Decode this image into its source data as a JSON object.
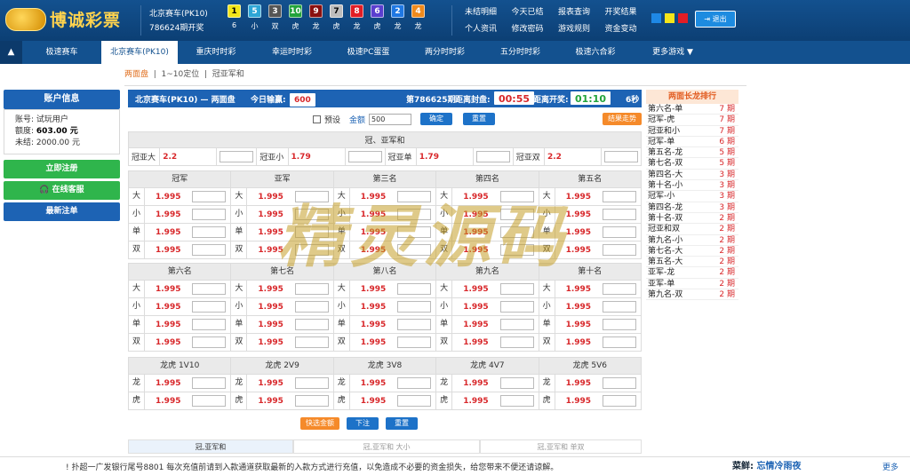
{
  "header": {
    "logo_text": "博诚彩票",
    "game_name": "北京赛车(PK10)",
    "draw_issue": "786624期开奖",
    "balls": [
      {
        "num": "1",
        "color": "#f2e51a",
        "text_color": "#000",
        "sub": "6"
      },
      {
        "num": "5",
        "color": "#2ea6d6",
        "text_color": "#fff",
        "sub": "小"
      },
      {
        "num": "3",
        "color": "#555555",
        "text_color": "#fff",
        "sub": "双"
      },
      {
        "num": "10",
        "color": "#22a33b",
        "text_color": "#fff",
        "sub": "虎"
      },
      {
        "num": "9",
        "color": "#8a1010",
        "text_color": "#fff",
        "sub": "龙"
      },
      {
        "num": "7",
        "color": "#bdbdbd",
        "text_color": "#000",
        "sub": "虎"
      },
      {
        "num": "8",
        "color": "#e21d25",
        "text_color": "#fff",
        "sub": "龙"
      },
      {
        "num": "6",
        "color": "#5a3fcf",
        "text_color": "#fff",
        "sub": "虎"
      },
      {
        "num": "2",
        "color": "#1f78e3",
        "text_color": "#fff",
        "sub": "龙"
      },
      {
        "num": "4",
        "color": "#f08a1c",
        "text_color": "#fff",
        "sub": "龙"
      }
    ],
    "nav_links": [
      "未结明细",
      "今天已结",
      "报表查询",
      "开奖结果",
      "个人资讯",
      "修改密码",
      "游戏规则",
      "资金变动"
    ],
    "theme_swatches": [
      "#1e88e5",
      "#f5e51a",
      "#e21d25"
    ],
    "logout_label": "退出"
  },
  "game_nav": {
    "items": [
      "极速赛车",
      "北京赛车(PK10)",
      "重庆时时彩",
      "幸运时时彩",
      "极速PC蛋蛋",
      "两分时时彩",
      "五分时时彩",
      "极速六合彩",
      "更多游戏 ▼"
    ],
    "active": 1
  },
  "subnav": {
    "items": [
      "两面盘",
      "1~10定位",
      "冠亚军和"
    ],
    "active": 0
  },
  "account": {
    "title": "账户信息",
    "rows": [
      {
        "label": "账号:",
        "value": "试玩用户"
      },
      {
        "label": "额度:",
        "value": "603.00 元",
        "bold": true
      },
      {
        "label": "未结:",
        "value": "2000.00 元"
      }
    ],
    "register": "立即注册",
    "service": "在线客服",
    "latest": "最新注单"
  },
  "main_bar": {
    "title": "北京赛车(PK10) — 两面盘",
    "today_label": "今日输赢:",
    "today_value": "600",
    "issue": "第786625期",
    "close_label": "距离封盘:",
    "close_time": "00:55",
    "open_label": "距离开奖:",
    "open_time": "01:10",
    "refresh": "6秒"
  },
  "controls": {
    "preset": "预设",
    "amount_label": "金额",
    "amount_value": "500",
    "confirm": "确定",
    "reset": "重置",
    "trend": "结果走势"
  },
  "gy": {
    "title": "冠、亚军和",
    "items": [
      {
        "label": "冠亚大",
        "odds": "2.2"
      },
      {
        "label": "冠亚小",
        "odds": "1.79"
      },
      {
        "label": "冠亚单",
        "odds": "1.79"
      },
      {
        "label": "冠亚双",
        "odds": "2.2"
      }
    ]
  },
  "positions_a": [
    {
      "title": "冠军",
      "rows": [
        [
          "大",
          "1.995"
        ],
        [
          "小",
          "1.995"
        ],
        [
          "单",
          "1.995"
        ],
        [
          "双",
          "1.995"
        ]
      ]
    },
    {
      "title": "亚军",
      "rows": [
        [
          "大",
          "1.995"
        ],
        [
          "小",
          "1.995"
        ],
        [
          "单",
          "1.995"
        ],
        [
          "双",
          "1.995"
        ]
      ]
    },
    {
      "title": "第三名",
      "rows": [
        [
          "大",
          "1.995"
        ],
        [
          "小",
          "1.995"
        ],
        [
          "单",
          "1.995"
        ],
        [
          "双",
          "1.995"
        ]
      ]
    },
    {
      "title": "第四名",
      "rows": [
        [
          "大",
          "1.995"
        ],
        [
          "小",
          "1.995"
        ],
        [
          "单",
          "1.995"
        ],
        [
          "双",
          "1.995"
        ]
      ]
    },
    {
      "title": "第五名",
      "rows": [
        [
          "大",
          "1.995"
        ],
        [
          "小",
          "1.995"
        ],
        [
          "单",
          "1.995"
        ],
        [
          "双",
          "1.995"
        ]
      ]
    }
  ],
  "positions_b": [
    {
      "title": "第六名",
      "rows": [
        [
          "大",
          "1.995"
        ],
        [
          "小",
          "1.995"
        ],
        [
          "单",
          "1.995"
        ],
        [
          "双",
          "1.995"
        ]
      ]
    },
    {
      "title": "第七名",
      "rows": [
        [
          "大",
          "1.995"
        ],
        [
          "小",
          "1.995"
        ],
        [
          "单",
          "1.995"
        ],
        [
          "双",
          "1.995"
        ]
      ]
    },
    {
      "title": "第八名",
      "rows": [
        [
          "大",
          "1.995"
        ],
        [
          "小",
          "1.995"
        ],
        [
          "单",
          "1.995"
        ],
        [
          "双",
          "1.995"
        ]
      ]
    },
    {
      "title": "第九名",
      "rows": [
        [
          "大",
          "1.995"
        ],
        [
          "小",
          "1.995"
        ],
        [
          "单",
          "1.995"
        ],
        [
          "双",
          "1.995"
        ]
      ]
    },
    {
      "title": "第十名",
      "rows": [
        [
          "大",
          "1.995"
        ],
        [
          "小",
          "1.995"
        ],
        [
          "单",
          "1.995"
        ],
        [
          "双",
          "1.995"
        ]
      ]
    }
  ],
  "dragon_tiger": [
    {
      "title": "龙虎 1V10",
      "rows": [
        [
          "龙",
          "1.995"
        ],
        [
          "虎",
          "1.995"
        ]
      ]
    },
    {
      "title": "龙虎 2V9",
      "rows": [
        [
          "龙",
          "1.995"
        ],
        [
          "虎",
          "1.995"
        ]
      ]
    },
    {
      "title": "龙虎 3V8",
      "rows": [
        [
          "龙",
          "1.995"
        ],
        [
          "虎",
          "1.995"
        ]
      ]
    },
    {
      "title": "龙虎 4V7",
      "rows": [
        [
          "龙",
          "1.995"
        ],
        [
          "虎",
          "1.995"
        ]
      ]
    },
    {
      "title": "龙虎 5V6",
      "rows": [
        [
          "龙",
          "1.995"
        ],
        [
          "虎",
          "1.995"
        ]
      ]
    }
  ],
  "bottom_buttons": {
    "quick": "快选金额",
    "submit": "下注",
    "reset": "重置"
  },
  "bottom_tabs": [
    "冠,亚军和",
    "冠,亚军和 大小",
    "冠,亚军和 单双"
  ],
  "ranking": {
    "title": "两面长龙排行",
    "rows": [
      [
        "第六名-单",
        "7 期"
      ],
      [
        "冠军-虎",
        "7 期"
      ],
      [
        "冠亚和小",
        "7 期"
      ],
      [
        "冠军-单",
        "6 期"
      ],
      [
        "第五名-龙",
        "5 期"
      ],
      [
        "第七名-双",
        "5 期"
      ],
      [
        "第四名-大",
        "3 期"
      ],
      [
        "第十名-小",
        "3 期"
      ],
      [
        "冠军-小",
        "3 期"
      ],
      [
        "第四名-龙",
        "3 期"
      ],
      [
        "第十名-双",
        "2 期"
      ],
      [
        "冠亚和双",
        "2 期"
      ],
      [
        "第九名-小",
        "2 期"
      ],
      [
        "第七名-大",
        "2 期"
      ],
      [
        "第五名-大",
        "2 期"
      ],
      [
        "亚军-龙",
        "2 期"
      ],
      [
        "亚军-单",
        "2 期"
      ],
      [
        "第九名-双",
        "2 期"
      ]
    ]
  },
  "watermark": "精灵源码",
  "footer": {
    "message": "! 扑超一广发银行尾号8801 每次充值前请到入款通道获取最新的入款方式进行充值，以免造成不必要的资金损失，给您带来不便还请谅解。",
    "signature_label": "菜鲜:",
    "signature_name": "忘情冷雨夜",
    "more": "更多"
  }
}
